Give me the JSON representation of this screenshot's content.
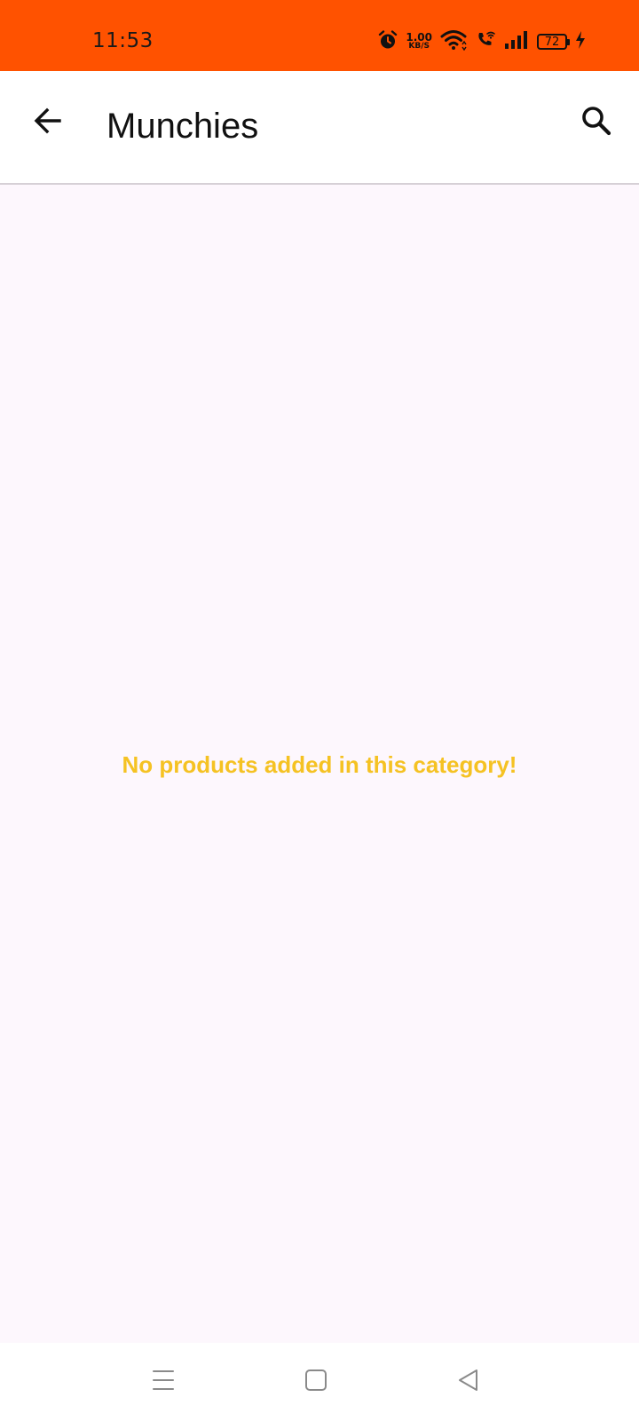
{
  "status_bar": {
    "time": "11:53",
    "net_speed_value": "1.00",
    "net_speed_unit": "KB/S",
    "battery_level": "72",
    "background_color": "#ff5200"
  },
  "app_bar": {
    "title": "Munchies",
    "back_icon": "arrow-left-icon",
    "search_icon": "search-icon"
  },
  "content": {
    "empty_message": "No products added in this category!",
    "message_color": "#f5c223"
  },
  "nav_bar": {
    "menu_icon": "menu-icon",
    "home_icon": "square-icon",
    "back_icon": "triangle-back-icon"
  }
}
